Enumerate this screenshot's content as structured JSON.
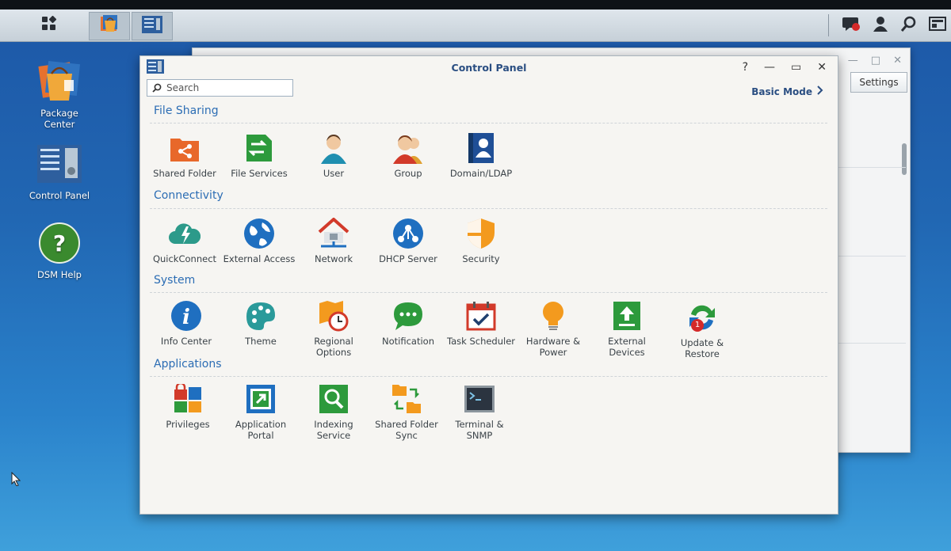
{
  "taskbar": {
    "icons": [
      "main-menu-icon",
      "package-center-icon",
      "control-panel-icon",
      "notification-icon",
      "user-icon",
      "search-icon",
      "widgets-icon"
    ],
    "colors": {
      "accent": "#2a4e82",
      "section": "#2c6db4"
    }
  },
  "desktop": {
    "icons": [
      {
        "label": "Package\nCenter",
        "icon": "package-center-icon"
      },
      {
        "label": "Control Panel",
        "icon": "control-panel-icon"
      },
      {
        "label": "DSM Help",
        "icon": "help-icon"
      }
    ]
  },
  "back_window": {
    "settings_label": "Settings"
  },
  "control_panel": {
    "title": "Control Panel",
    "search_placeholder": "Search",
    "basic_mode_label": "Basic Mode",
    "sections": [
      {
        "title": "File Sharing",
        "items": [
          {
            "label": "Shared Folder",
            "icon": "shared-folder-icon"
          },
          {
            "label": "File Services",
            "icon": "file-services-icon"
          },
          {
            "label": "User",
            "icon": "user-icon"
          },
          {
            "label": "Group",
            "icon": "group-icon"
          },
          {
            "label": "Domain/LDAP",
            "icon": "domain-ldap-icon"
          }
        ]
      },
      {
        "title": "Connectivity",
        "items": [
          {
            "label": "QuickConnect",
            "icon": "quickconnect-icon"
          },
          {
            "label": "External Access",
            "icon": "external-access-icon"
          },
          {
            "label": "Network",
            "icon": "network-icon"
          },
          {
            "label": "DHCP Server",
            "icon": "dhcp-server-icon"
          },
          {
            "label": "Security",
            "icon": "security-icon"
          }
        ]
      },
      {
        "title": "System",
        "items": [
          {
            "label": "Info Center",
            "icon": "info-center-icon"
          },
          {
            "label": "Theme",
            "icon": "theme-icon"
          },
          {
            "label": "Regional Options",
            "icon": "regional-options-icon"
          },
          {
            "label": "Notification",
            "icon": "notification-icon"
          },
          {
            "label": "Task Scheduler",
            "icon": "task-scheduler-icon"
          },
          {
            "label": "Hardware & Power",
            "icon": "hardware-power-icon"
          },
          {
            "label": "External Devices",
            "icon": "external-devices-icon"
          },
          {
            "label": "Update & Restore",
            "icon": "update-restore-icon",
            "badge": "1"
          }
        ]
      },
      {
        "title": "Applications",
        "items": [
          {
            "label": "Privileges",
            "icon": "privileges-icon"
          },
          {
            "label": "Application Portal",
            "icon": "application-portal-icon"
          },
          {
            "label": "Indexing Service",
            "icon": "indexing-service-icon"
          },
          {
            "label": "Shared Folder Sync",
            "icon": "shared-folder-sync-icon"
          },
          {
            "label": "Terminal & SNMP",
            "icon": "terminal-snmp-icon"
          }
        ]
      }
    ]
  }
}
